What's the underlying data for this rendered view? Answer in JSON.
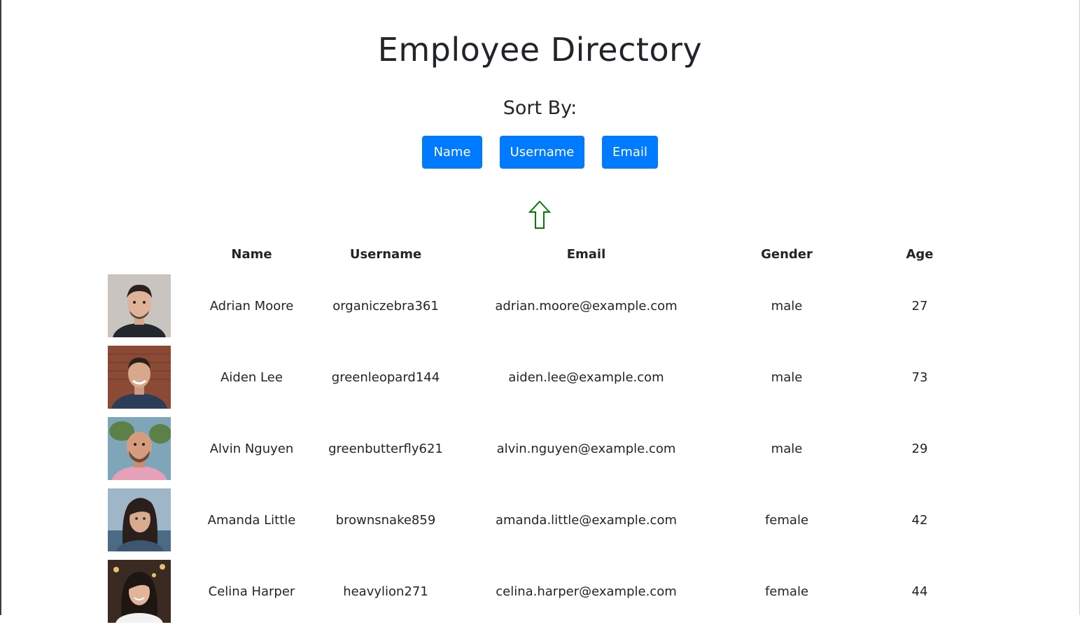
{
  "page": {
    "title": "Employee Directory",
    "sort_label": "Sort By:"
  },
  "sort_buttons": {
    "name": "Name",
    "username": "Username",
    "email": "Email"
  },
  "sort_indicator": {
    "icon": "up-arrow-icon",
    "color": "#008000"
  },
  "accent_color": "#007bff",
  "table": {
    "headers": {
      "photo": "",
      "name": "Name",
      "username": "Username",
      "email": "Email",
      "gender": "Gender",
      "age": "Age"
    },
    "rows": [
      {
        "name": "Adrian Moore",
        "username": "organiczebra361",
        "email": "adrian.moore@example.com",
        "gender": "male",
        "age": "27"
      },
      {
        "name": "Aiden Lee",
        "username": "greenleopard144",
        "email": "aiden.lee@example.com",
        "gender": "male",
        "age": "73"
      },
      {
        "name": "Alvin Nguyen",
        "username": "greenbutterfly621",
        "email": "alvin.nguyen@example.com",
        "gender": "male",
        "age": "29"
      },
      {
        "name": "Amanda Little",
        "username": "brownsnake859",
        "email": "amanda.little@example.com",
        "gender": "female",
        "age": "42"
      },
      {
        "name": "Celina Harper",
        "username": "heavylion271",
        "email": "celina.harper@example.com",
        "gender": "female",
        "age": "44"
      }
    ]
  }
}
